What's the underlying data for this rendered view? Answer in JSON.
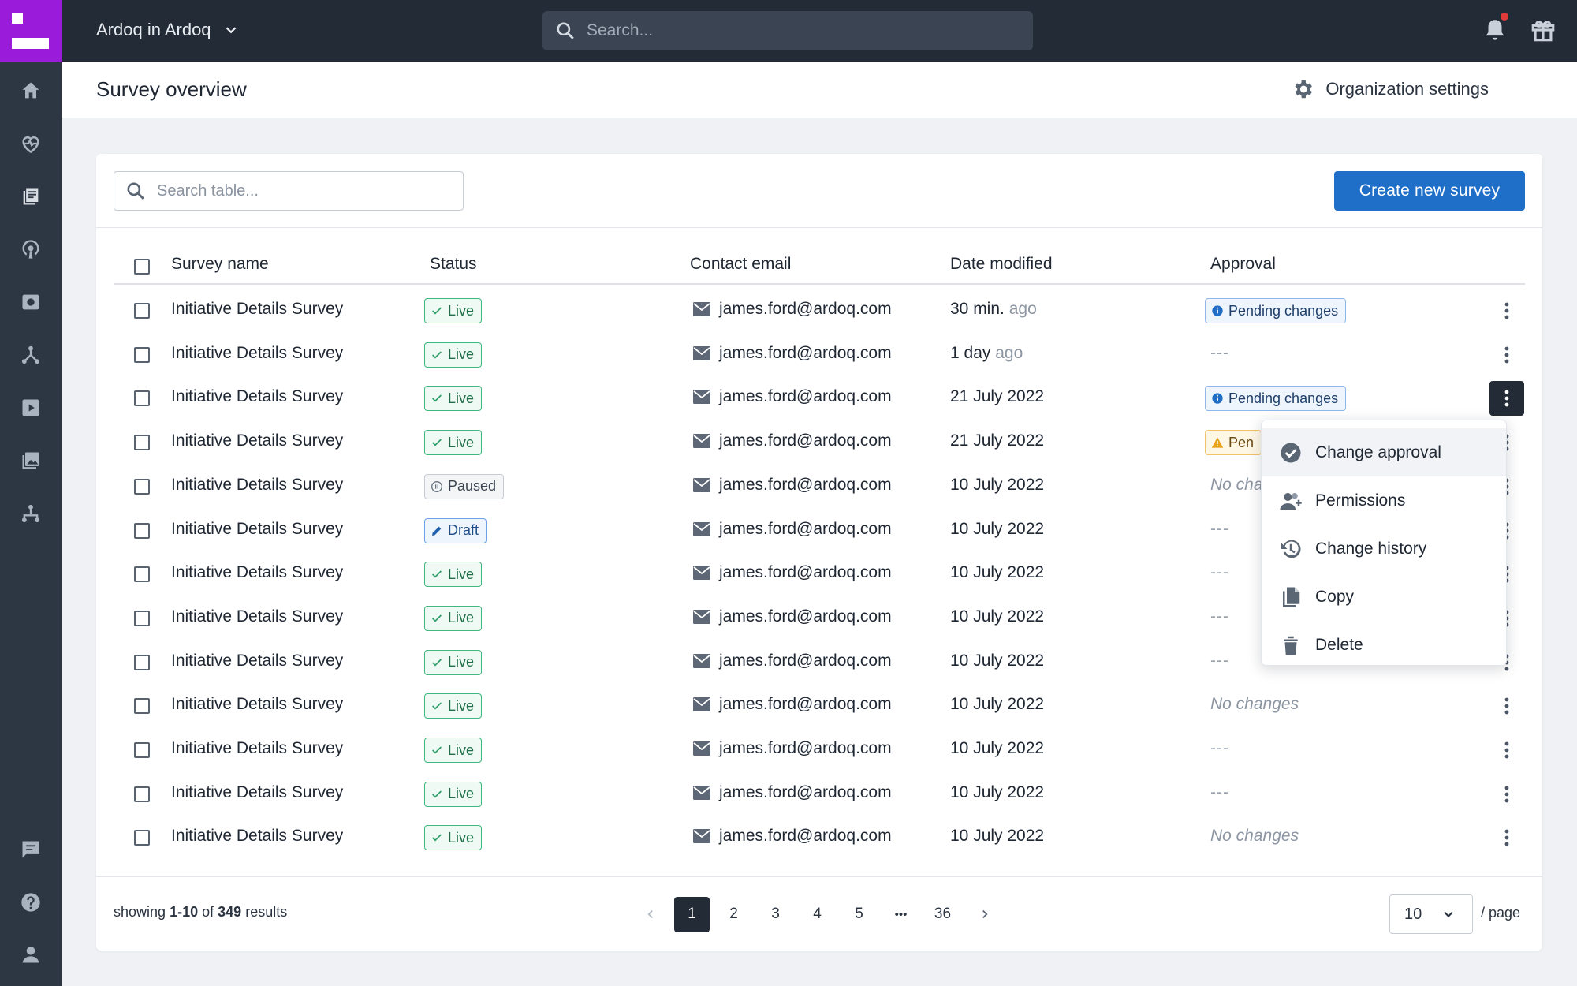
{
  "topbar": {
    "workspace": "Ardoq in Ardoq",
    "search_placeholder": "Search..."
  },
  "page": {
    "title": "Survey overview",
    "org_settings": "Organization settings"
  },
  "toolbar": {
    "search_placeholder": "Search table...",
    "create_label": "Create new survey"
  },
  "table": {
    "headers": [
      "Survey name",
      "Status",
      "Contact email",
      "Date modified",
      "Approval"
    ],
    "rows": [
      {
        "name": "Initiative Details Survey",
        "status": "Live",
        "email": "james.ford@ardoq.com",
        "date": "30 min.",
        "date_suffix": "ago",
        "approval": "Pending changes",
        "approval_type": "pending"
      },
      {
        "name": "Initiative Details Survey",
        "status": "Live",
        "email": "james.ford@ardoq.com",
        "date": "1 day",
        "date_suffix": "ago",
        "approval": "---",
        "approval_type": "dash"
      },
      {
        "name": "Initiative Details Survey",
        "status": "Live",
        "email": "james.ford@ardoq.com",
        "date": "21 July 2022",
        "date_suffix": "",
        "approval": "Pending changes",
        "approval_type": "pending"
      },
      {
        "name": "Initiative Details Survey",
        "status": "Live",
        "email": "james.ford@ardoq.com",
        "date": "21 July 2022",
        "date_suffix": "",
        "approval": "Pen",
        "approval_type": "warn"
      },
      {
        "name": "Initiative Details Survey",
        "status": "Paused",
        "email": "james.ford@ardoq.com",
        "date": "10 July 2022",
        "date_suffix": "",
        "approval": "No cha",
        "approval_type": "nochg"
      },
      {
        "name": "Initiative Details Survey",
        "status": "Draft",
        "email": "james.ford@ardoq.com",
        "date": "10 July 2022",
        "date_suffix": "",
        "approval": "---",
        "approval_type": "dash"
      },
      {
        "name": "Initiative Details Survey",
        "status": "Live",
        "email": "james.ford@ardoq.com",
        "date": "10 July 2022",
        "date_suffix": "",
        "approval": "---",
        "approval_type": "dash"
      },
      {
        "name": "Initiative Details Survey",
        "status": "Live",
        "email": "james.ford@ardoq.com",
        "date": "10 July 2022",
        "date_suffix": "",
        "approval": "---",
        "approval_type": "dash"
      },
      {
        "name": "Initiative Details Survey",
        "status": "Live",
        "email": "james.ford@ardoq.com",
        "date": "10 July 2022",
        "date_suffix": "",
        "approval": "---",
        "approval_type": "dash"
      },
      {
        "name": "Initiative Details Survey",
        "status": "Live",
        "email": "james.ford@ardoq.com",
        "date": "10 July 2022",
        "date_suffix": "",
        "approval": "No changes",
        "approval_type": "nochg"
      },
      {
        "name": "Initiative Details Survey",
        "status": "Live",
        "email": "james.ford@ardoq.com",
        "date": "10 July 2022",
        "date_suffix": "",
        "approval": "---",
        "approval_type": "dash"
      },
      {
        "name": "Initiative Details Survey",
        "status": "Live",
        "email": "james.ford@ardoq.com",
        "date": "10 July 2022",
        "date_suffix": "",
        "approval": "---",
        "approval_type": "dash"
      },
      {
        "name": "Initiative Details Survey",
        "status": "Live",
        "email": "james.ford@ardoq.com",
        "date": "10 July 2022",
        "date_suffix": "",
        "approval": "No changes",
        "approval_type": "nochg"
      }
    ]
  },
  "menu": {
    "items": [
      {
        "label": "Change approval",
        "icon": "check-circle-icon"
      },
      {
        "label": "Permissions",
        "icon": "user-add-icon"
      },
      {
        "label": "Change history",
        "icon": "history-icon"
      },
      {
        "label": "Copy",
        "icon": "copy-icon"
      },
      {
        "label": "Delete",
        "icon": "trash-icon"
      }
    ]
  },
  "footer": {
    "showing_prefix": "showing",
    "showing_range": "1-10",
    "showing_of": "of",
    "showing_total": "349",
    "showing_suffix": "results",
    "pages": [
      "1",
      "2",
      "3",
      "4",
      "5",
      "•••",
      "36"
    ],
    "current_page": "1",
    "page_size": "10",
    "per_page_label": "/ page"
  },
  "colors": {
    "rail": "#2d3643",
    "topbar": "#222b36",
    "brand": "#9a1bd9",
    "primary": "#1f6fc9",
    "live": "#3fb87f"
  }
}
